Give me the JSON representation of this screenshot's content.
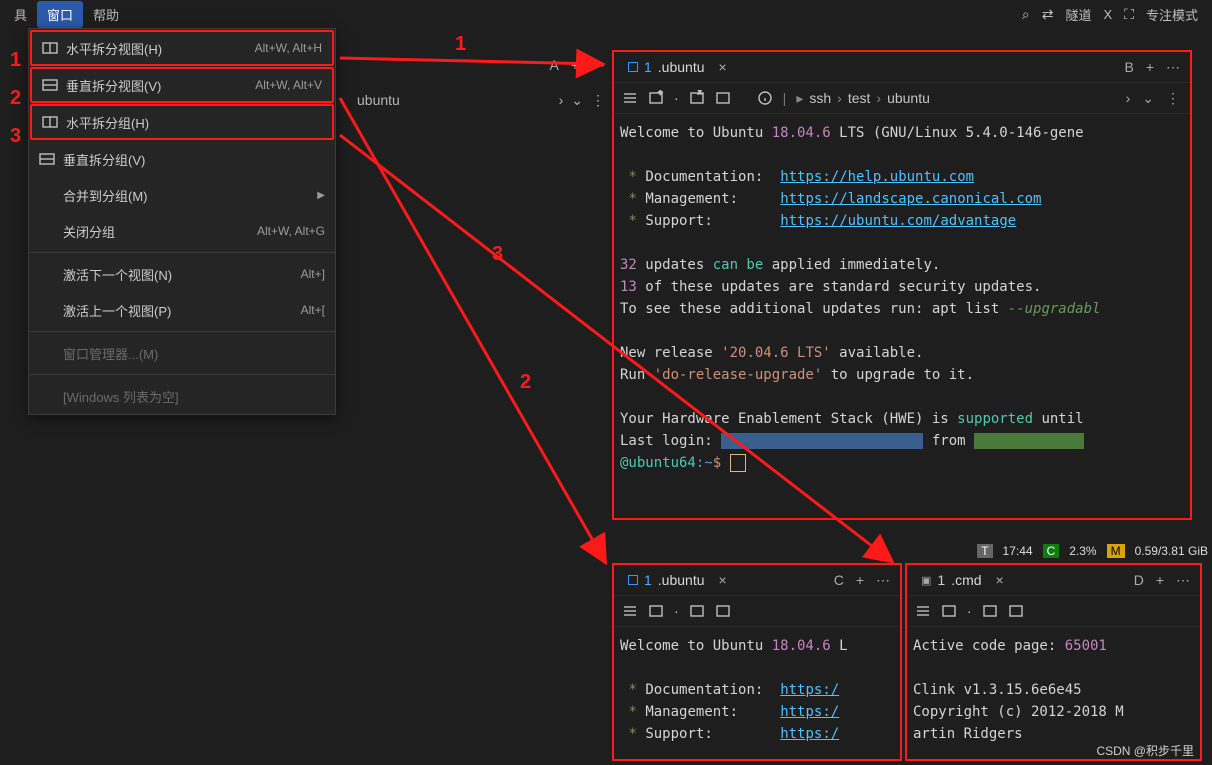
{
  "menubar": {
    "items": [
      {
        "label": "具"
      },
      {
        "label": "窗口",
        "active": true
      },
      {
        "label": "帮助"
      }
    ],
    "right": {
      "tunnel": "隧道",
      "x": "X",
      "focus": "专注模式"
    }
  },
  "menu": {
    "items": [
      {
        "icon": "split-h",
        "label": "水平拆分视图(H)",
        "shortcut": "Alt+W, Alt+H",
        "hl": true
      },
      {
        "icon": "split-v",
        "label": "垂直拆分视图(V)",
        "shortcut": "Alt+W, Alt+V",
        "hl": true
      },
      {
        "icon": "split-h",
        "label": "水平拆分组(H)",
        "shortcut": "",
        "hl": true
      },
      {
        "icon": "split-v",
        "label": "垂直拆分组(V)",
        "shortcut": ""
      },
      {
        "label": "合并到分组(M)",
        "submenu": true
      },
      {
        "label": "关闭分组",
        "shortcut": "Alt+W, Alt+G"
      },
      {
        "sep": true
      },
      {
        "label": "激活下一个视图(N)",
        "shortcut": "Alt+]"
      },
      {
        "label": "激活上一个视图(P)",
        "shortcut": "Alt+["
      },
      {
        "sep": true
      },
      {
        "label": "窗口管理器...(M)",
        "disabled": true
      },
      {
        "sep": true
      },
      {
        "label": "[Windows 列表为空]",
        "disabled": true
      }
    ]
  },
  "annotations": {
    "n1": "1",
    "n2": "2",
    "n3": "3",
    "arrow1": "1",
    "arrow2": "2",
    "arrow3": "3"
  },
  "panelA": {
    "label": "A",
    "breadcrumb": "ubuntu"
  },
  "panelB": {
    "label": "B",
    "tab": {
      "num": "1",
      "name": ".ubuntu"
    },
    "breadcrumb": [
      "ssh",
      "test",
      "ubuntu"
    ],
    "term": {
      "l1a": "Welcome to Ubuntu ",
      "l1b": "18.04.6",
      "l1c": " LTS (GNU/Linux 5.4.0-146-gene",
      "doc": "Documentation:",
      "docUrl": "https://help.ubuntu.com",
      "mgmt": "Management:",
      "mgmtUrl": "https://landscape.canonical.com",
      "sup": "Support:",
      "supUrl": "https://ubuntu.com/advantage",
      "u1a": "32",
      "u1b": " updates ",
      "u1c": "can be",
      "u1d": " applied immediately.",
      "u2a": "13",
      "u2b": " of these updates are standard security updates.",
      "u3a": "To see these additional updates run: apt list ",
      "u3b": "--upgradabl",
      "r1a": "New release ",
      "r1b": "'20.04.6 LTS'",
      "r1c": " available.",
      "r2a": "Run ",
      "r2b": "'do-release-upgrade'",
      "r2c": " to upgrade to it.",
      "h1a": "Your Hardware Enablement Stack (HWE) is ",
      "h1b": "supported",
      "h1c": " until",
      "last": "Last login: ",
      "promptHost": "@ubuntu64",
      "promptPath": ":~",
      "promptSym": "$"
    }
  },
  "statusbar": {
    "tLabel": "T",
    "time": "17:44",
    "cLabel": "C",
    "cpu": "2.3%",
    "mLabel": "M",
    "mem": "0.59/3.81 GiB"
  },
  "panelC": {
    "label": "C",
    "tab": {
      "num": "1",
      "name": ".ubuntu"
    },
    "term": {
      "l1a": "Welcome to Ubuntu ",
      "l1b": "18.04.6",
      "l1c": " L",
      "doc": "Documentation:",
      "docUrl": "https:/",
      "mgmt": "Management:",
      "mgmtUrl": "https:/",
      "sup": "Support:",
      "supUrl": "https:/"
    }
  },
  "panelD": {
    "label": "D",
    "tab": {
      "num": "1",
      "name": ".cmd"
    },
    "term": {
      "l1a": "Active code page: ",
      "l1b": "65001",
      "l2": "Clink v1.3.15.6e6e45",
      "l3": "Copyright (c) 2012-2018 M",
      "l4": "artin Ridgers"
    }
  },
  "watermark": "CSDN @积步千里"
}
